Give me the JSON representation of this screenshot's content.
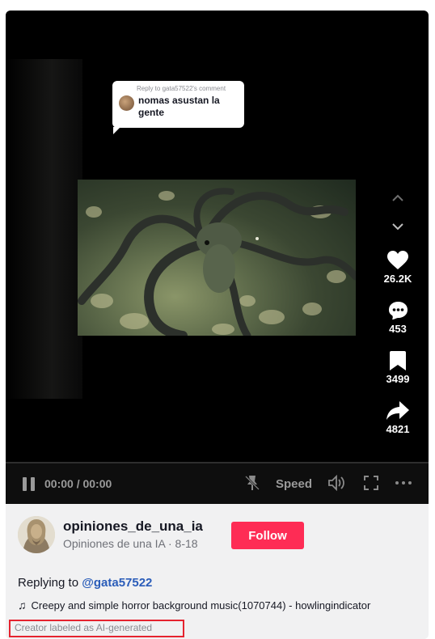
{
  "reply_bubble": {
    "label": "Reply to gata57522's comment",
    "text": "nomas asustan la gente"
  },
  "actions": {
    "likes": "26.2K",
    "comments": "453",
    "saves": "3499",
    "shares": "4821"
  },
  "player": {
    "time": "00:00 / 00:00",
    "speed_label": "Speed"
  },
  "post": {
    "username": "opiniones_de_una_ia",
    "display_name": "Opiniones de una IA",
    "date": "8-18",
    "subline": "Opiniones de una IA · 8-18",
    "follow_label": "Follow",
    "replying_prefix": "Replying to",
    "replying_mention": "@gata57522",
    "music": "Creepy and simple horror background music(1070744) - howlingindicator",
    "ai_label": "Creator labeled as AI-generated"
  },
  "colors": {
    "follow_bg": "#fe2c55",
    "mention": "#2b5db9",
    "highlight_box": "#e5232f"
  }
}
